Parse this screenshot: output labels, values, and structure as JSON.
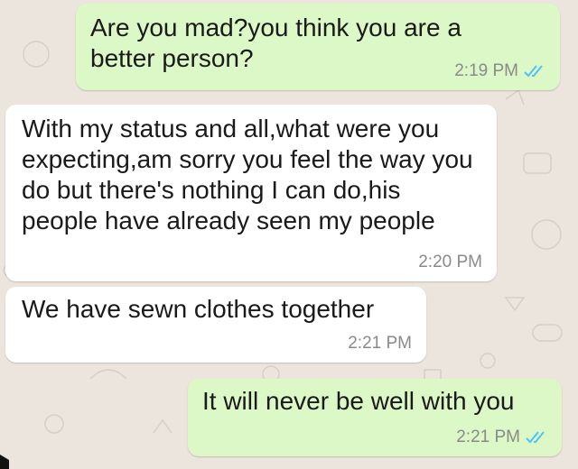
{
  "colors": {
    "chat_background": "#ece5dd",
    "outgoing_bubble": "#dcf8c6",
    "incoming_bubble": "#ffffff",
    "timestamp": "#8a8a8a",
    "read_ticks": "#4fc3f7"
  },
  "messages": [
    {
      "direction": "outgoing",
      "text": "Are you mad?you think you are a better person?",
      "time": "2:19 PM",
      "status_icon": "double-check-read-icon"
    },
    {
      "direction": "incoming",
      "text": "With my status and all,what were you expecting,am sorry you feel the way you do but there's nothing I can do,his people have already seen my people",
      "time": "2:20 PM"
    },
    {
      "direction": "incoming",
      "text": "We have sewn clothes together",
      "time": "2:21 PM"
    },
    {
      "direction": "outgoing",
      "text": "It will never be well with you",
      "time": "2:21 PM",
      "status_icon": "double-check-read-icon"
    }
  ]
}
